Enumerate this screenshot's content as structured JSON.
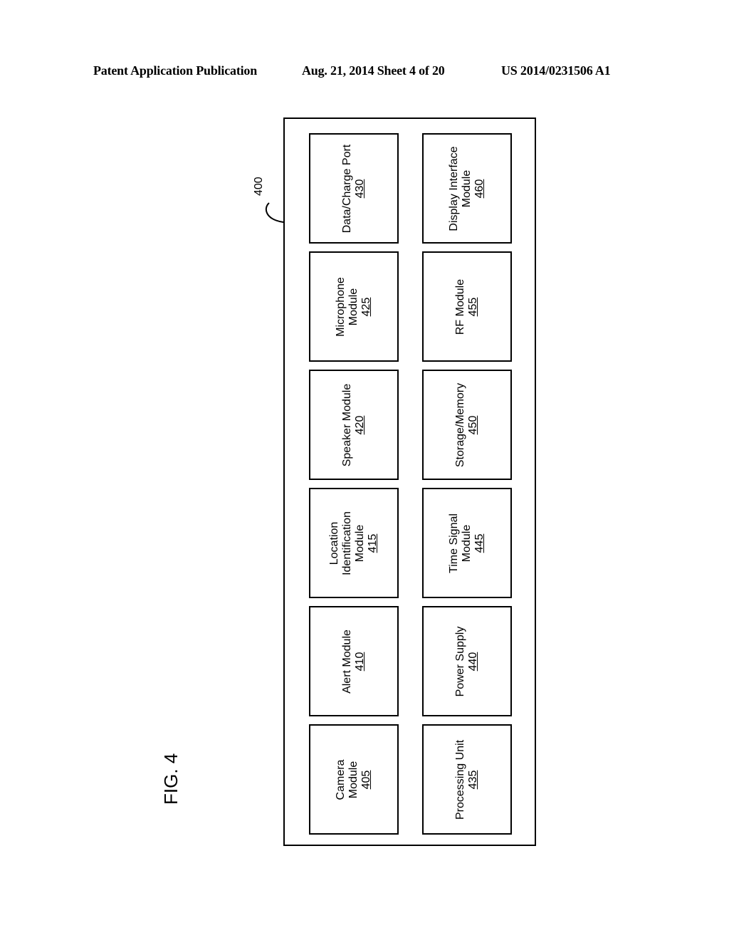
{
  "header": {
    "publication": "Patent Application Publication",
    "date_sheet": "Aug. 21, 2014  Sheet 4 of 20",
    "number": "US 2014/0231506 A1"
  },
  "figure": {
    "label": "FIG. 4",
    "ref": "400",
    "modules": [
      {
        "name": "Camera Module",
        "num": "405"
      },
      {
        "name": "Alert Module",
        "num": "410"
      },
      {
        "name": "Location Identification Module",
        "num": "415"
      },
      {
        "name": "Speaker Module",
        "num": "420"
      },
      {
        "name": "Microphone Module",
        "num": "425"
      },
      {
        "name": "Data/Charge Port",
        "num": "430"
      },
      {
        "name": "Processing Unit",
        "num": "435"
      },
      {
        "name": "Power Supply",
        "num": "440"
      },
      {
        "name": "Time Signal Module",
        "num": "445"
      },
      {
        "name": "Storage/Memory",
        "num": "450"
      },
      {
        "name": "RF Module",
        "num": "455"
      },
      {
        "name": "Display Interface Module",
        "num": "460"
      }
    ],
    "label_lines": {
      "405": [
        "Camera",
        "Module"
      ],
      "410": [
        "Alert Module"
      ],
      "415": [
        "Location",
        "Identification",
        "Module"
      ],
      "420": [
        "Speaker Module"
      ],
      "425": [
        "Microphone",
        "Module"
      ],
      "430": [
        "Data/Charge Port"
      ],
      "435": [
        "Processing Unit"
      ],
      "440": [
        "Power Supply"
      ],
      "445": [
        "Time Signal",
        "Module"
      ],
      "450": [
        "Storage/Memory"
      ],
      "455": [
        "RF Module"
      ],
      "460": [
        "Display Interface",
        "Module"
      ]
    }
  }
}
